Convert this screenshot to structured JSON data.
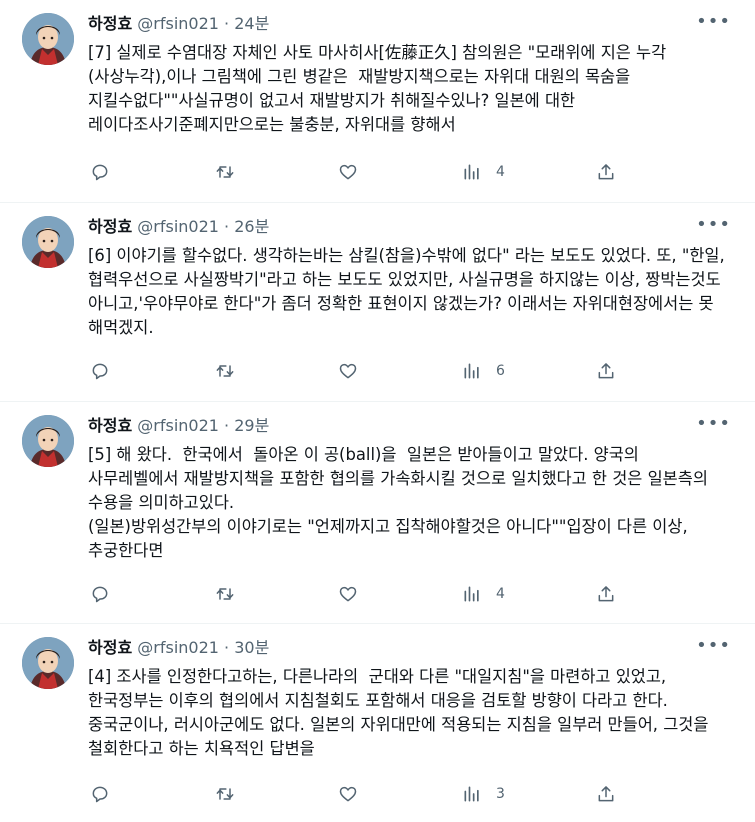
{
  "tweets": [
    {
      "user_name": "하정효",
      "handle": "@rfsin021",
      "separator": "·",
      "time": "24분",
      "text": "[7] 실제로 수염대장 자체인 사토 마사히사[佐藤正久] 참의원은 \"모래위에 지은 누각(사상누각),이나 그림책에 그린 병같은  재발방지책으로는 자위대 대원의 목숨을 지킬수없다\"\"사실규명이 없고서 재발방지가 취해질수있나? 일본에 대한 레이다조사기준폐지만으로는 불충분, 자위대를 향해서",
      "views": "4"
    },
    {
      "user_name": "하정효",
      "handle": "@rfsin021",
      "separator": "·",
      "time": "26분",
      "text": "[6] 이야기를 할수없다. 생각하는바는 삼킬(참을)수밖에 없다\" 라는 보도도 있었다. 또, \"한일, 협력우선으로 사실짱박기\"라고 하는 보도도 있었지만, 사실규명을 하지않는 이상, 짱박는것도 아니고,'우야무야로 한다\"가 좀더 정확한 표현이지 않겠는가? 이래서는 자위대현장에서는 못 해먹겠지.",
      "views": "6"
    },
    {
      "user_name": "하정효",
      "handle": "@rfsin021",
      "separator": "·",
      "time": "29분",
      "text": "[5] 해 왔다.  한국에서  돌아온 이 공(ball)을  일본은 받아들이고 말았다. 양국의 사무레벨에서 재발방지책을 포함한 협의를 가속화시킬 것으로 일치했다고 한 것은 일본측의 수용을 의미하고있다.\n(일본)방위성간부의 이야기로는 \"언제까지고 집착해야할것은 아니다\"\"입장이 다른 이상, 추궁한다면",
      "views": "4"
    },
    {
      "user_name": "하정효",
      "handle": "@rfsin021",
      "separator": "·",
      "time": "30분",
      "text": "[4] 조사를 인정한다고하는, 다른나라의  군대와 다른 \"대일지침\"을 마련하고 있었고, 한국정부는 이후의 협의에서 지침철회도 포함해서 대응을 검토할 방향이 다라고 한다. 중국군이나, 러시아군에도 없다. 일본의 자위대만에 적용되는 지침을 일부러 만들어, 그것을 철회한다고 하는 치욕적인 답변을",
      "views": "3"
    }
  ],
  "icons": {
    "more": "more-dots-icon",
    "reply": "reply-icon",
    "retweet": "retweet-icon",
    "like": "like-icon",
    "views": "views-icon",
    "share": "share-icon"
  },
  "colors": {
    "text": "#0f1419",
    "secondary": "#536471",
    "border": "#eff3f4"
  }
}
